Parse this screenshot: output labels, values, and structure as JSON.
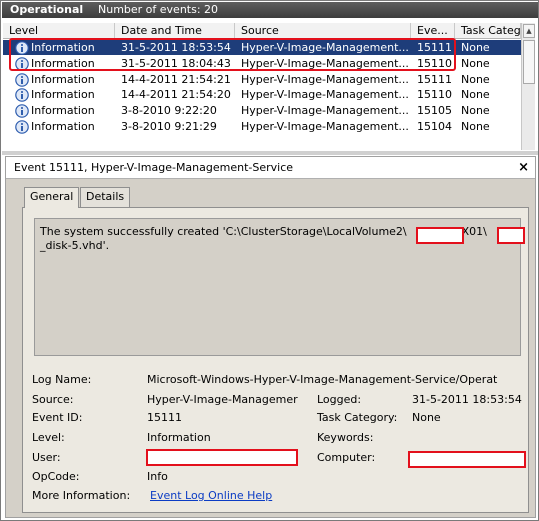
{
  "header": {
    "title": "Operational",
    "count_text": "Number of events: 20"
  },
  "columns": [
    "Level",
    "Date and Time",
    "Source",
    "Eve...",
    "Task Categ"
  ],
  "rows": [
    {
      "level": "Information",
      "datetime": "31-5-2011 18:53:54",
      "source": "Hyper-V-Image-Management...",
      "event_id": "15111",
      "task": "None",
      "selected": true
    },
    {
      "level": "Information",
      "datetime": "31-5-2011 18:04:43",
      "source": "Hyper-V-Image-Management...",
      "event_id": "15110",
      "task": "None",
      "selected": false
    },
    {
      "level": "Information",
      "datetime": "14-4-2011 21:54:21",
      "source": "Hyper-V-Image-Management...",
      "event_id": "15111",
      "task": "None",
      "selected": false
    },
    {
      "level": "Information",
      "datetime": "14-4-2011 21:54:20",
      "source": "Hyper-V-Image-Management...",
      "event_id": "15110",
      "task": "None",
      "selected": false
    },
    {
      "level": "Information",
      "datetime": "3-8-2010 9:22:20",
      "source": "Hyper-V-Image-Management...",
      "event_id": "15105",
      "task": "None",
      "selected": false
    },
    {
      "level": "Information",
      "datetime": "3-8-2010 9:21:29",
      "source": "Hyper-V-Image-Management...",
      "event_id": "15104",
      "task": "None",
      "selected": false
    }
  ],
  "detail": {
    "title": "Event 15111, Hyper-V-Image-Management-Service",
    "close": "×",
    "tabs": [
      "General",
      "Details"
    ],
    "message_line1_a": "The system successfully created 'C:\\ClusterStorage\\LocalVolume2\\",
    "message_line1_b": "EX01\\",
    "message_line2": "_disk-5.vhd'.",
    "labels": {
      "log_name": "Log Name:",
      "source": "Source:",
      "event_id": "Event ID:",
      "level": "Level:",
      "user": "User:",
      "opcode": "OpCode:",
      "more_info": "More Information:",
      "logged": "Logged:",
      "task_category": "Task Category:",
      "keywords": "Keywords:",
      "computer": "Computer:"
    },
    "values": {
      "log_name": "Microsoft-Windows-Hyper-V-Image-Management-Service/Operat",
      "source": "Hyper-V-Image-Managemer",
      "event_id": "15111",
      "level": "Information",
      "opcode": "Info",
      "more_info_link": "Event Log Online Help",
      "logged": "31-5-2011 18:53:54",
      "task_category": "None",
      "keywords": ""
    }
  },
  "colors": {
    "header_bg": "#4a4a4a",
    "selected_row": "#1e3d7a",
    "redaction_border": "#e3101c",
    "pane_bg": "#d4d0c8",
    "link": "#0b3cc4"
  },
  "icons": {
    "row_level_icon": "information-icon",
    "close": "close-icon"
  }
}
